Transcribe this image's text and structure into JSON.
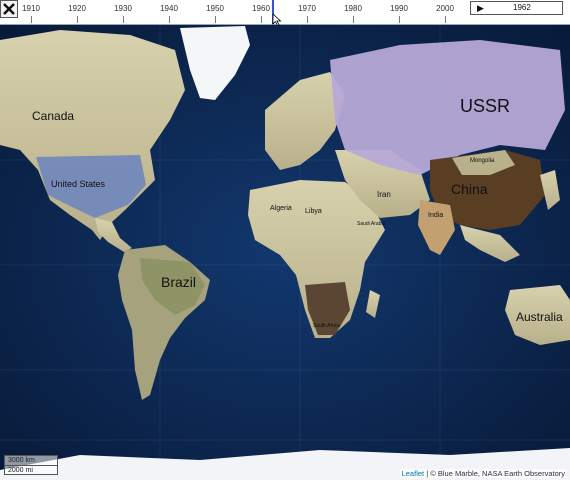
{
  "timeline": {
    "ticks": [
      "1910",
      "1920",
      "1930",
      "1940",
      "1950",
      "1960",
      "1970",
      "1980",
      "1990",
      "2000"
    ],
    "current_year": "1962",
    "play_icon": "▶"
  },
  "map": {
    "countries": {
      "canada": "Canada",
      "united_states": "United States",
      "brazil": "Brazil",
      "ussr": "USSR",
      "china": "China",
      "mongolia": "Mongolia",
      "india": "India",
      "iran": "Iran",
      "algeria": "Algeria",
      "libya": "Libya",
      "saudi_arabia": "Saudi Arabia",
      "south_africa": "South Africa",
      "australia": "Australia"
    },
    "scale": {
      "km": "3000 km",
      "mi": "2000 mi"
    },
    "attribution": {
      "link": "Leaflet",
      "text": " | © Blue Marble, NASA Earth Observatory"
    }
  },
  "colors": {
    "ocean": "#0d2c5c",
    "land": "#c9c3a0",
    "ussr_fill": "#b7a9d8",
    "china_fill": "#5a3e24",
    "us_fill": "#6f86bd",
    "cursor": "#3a4fd6",
    "ice": "#ffffff"
  },
  "icons": {
    "close": "close-icon",
    "play": "play-icon",
    "cursor": "timeline-cursor-icon"
  }
}
